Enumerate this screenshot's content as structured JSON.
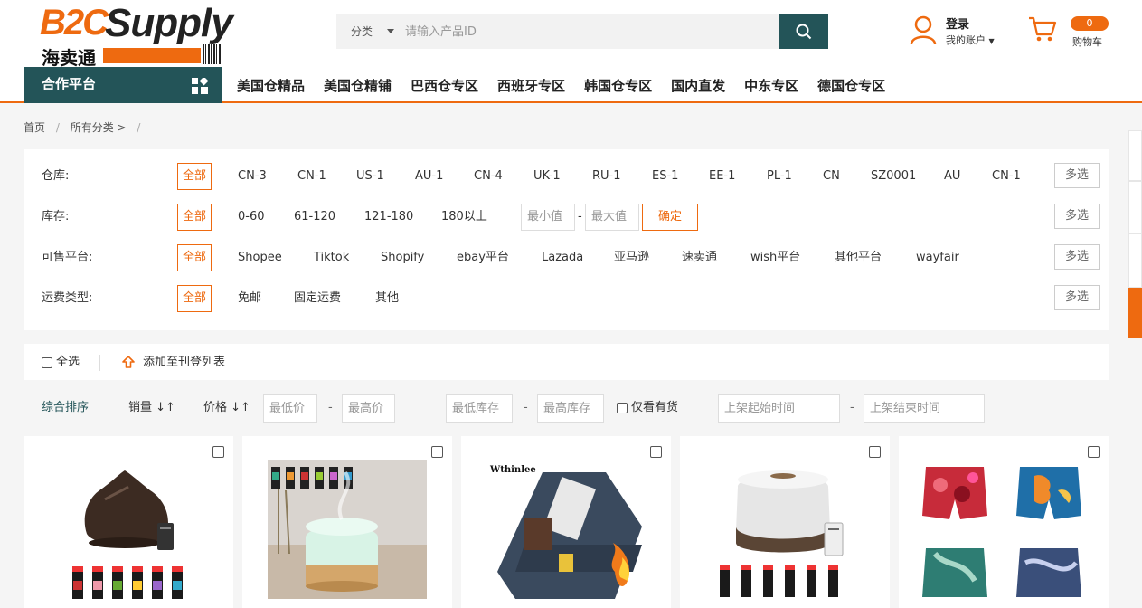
{
  "brand": {
    "logo_b2c": "B2C",
    "logo_supply": "Supply",
    "logo_cn": "海卖通"
  },
  "search": {
    "category": "分类",
    "placeholder": "请输入产品ID"
  },
  "account": {
    "login": "登录",
    "my_account": "我的账户"
  },
  "cart": {
    "count": "0",
    "label": "购物车"
  },
  "nav": {
    "partner": "合作平台",
    "links": [
      "美国仓精品",
      "美国仓精铺",
      "巴西仓专区",
      "西班牙专区",
      "韩国仓专区",
      "国内直发",
      "中东专区",
      "德国仓专区"
    ]
  },
  "breadcrumb": {
    "home": "首页",
    "sep": "/",
    "all": "所有分类 >",
    "sep2": "/"
  },
  "filters": {
    "warehouse": {
      "label": "仓库:",
      "all": "全部",
      "options": [
        "CN-3",
        "CN-1",
        "US-1",
        "AU-1",
        "CN-4",
        "UK-1",
        "RU-1",
        "ES-1",
        "EE-1",
        "PL-1",
        "CN",
        "SZ0001",
        "AU",
        "CN-1"
      ],
      "multi": "多选"
    },
    "stock": {
      "label": "库存:",
      "all": "全部",
      "options": [
        "0-60",
        "61-120",
        "121-180",
        "180以上"
      ],
      "min_placeholder": "最小值",
      "dash": "-",
      "max_placeholder": "最大值",
      "confirm": "确定",
      "multi": "多选"
    },
    "platform": {
      "label": "可售平台:",
      "all": "全部",
      "options": [
        "Shopee",
        "Tiktok",
        "Shopify",
        "ebay平台",
        "Lazada",
        "亚马逊",
        "速卖通",
        "wish平台",
        "其他平台",
        "wayfair"
      ],
      "multi": "多选"
    },
    "shipping": {
      "label": "运费类型:",
      "all": "全部",
      "options": [
        "免邮",
        "固定运费",
        "其他"
      ],
      "multi": "多选"
    }
  },
  "selection": {
    "select_all": "全选",
    "add_to_list": "添加至刊登列表"
  },
  "sort": {
    "overall": "综合排序",
    "sales": "销量 ↓↑",
    "price": "价格 ↓↑",
    "min_price": "最低价",
    "dash": "-",
    "max_price": "最高价",
    "min_stock": "最低库存",
    "max_stock": "最高库存",
    "in_stock": "仅看有货",
    "start_time": "上架起始时间",
    "end_time": "上架结束时间"
  },
  "products": [
    {
      "name": "diffuser-dark-wood"
    },
    {
      "name": "diffuser-glowing-white"
    },
    {
      "name": "jeans-wthinlee",
      "brand_text": "Wthinlee"
    },
    {
      "name": "diffuser-white-remote"
    },
    {
      "name": "swim-shorts-prints"
    }
  ],
  "colors": {
    "accent": "#ee6a10",
    "brand_dark": "#235458"
  }
}
